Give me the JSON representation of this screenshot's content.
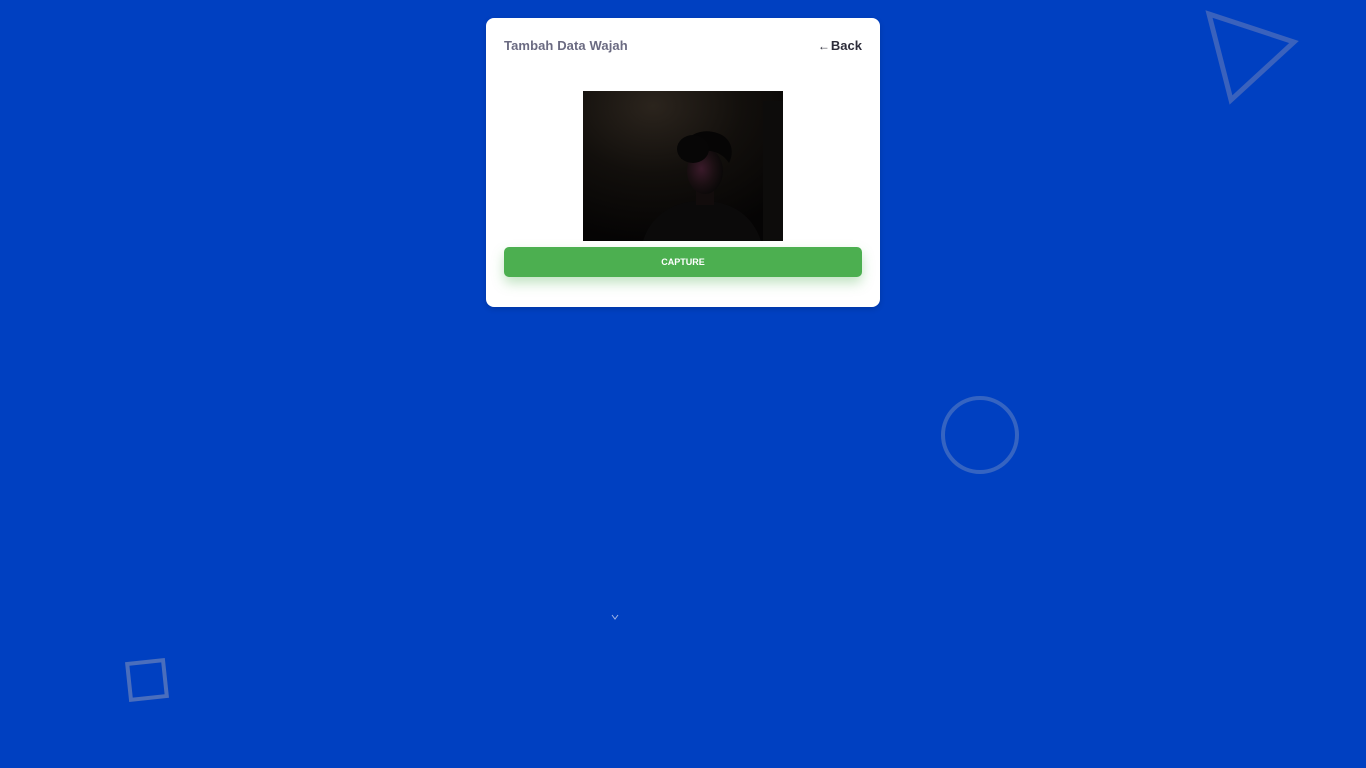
{
  "card": {
    "title": "Tambah Data Wajah",
    "back_arrow": "←",
    "back_label": "Back"
  },
  "camera": {
    "icon": "webcam-feed"
  },
  "capture_button": {
    "label": "CAPTURE"
  },
  "colors": {
    "background": "#0040c1",
    "card": "#ffffff",
    "button": "#4caf50",
    "decoration": "#3564c2"
  },
  "decorations": [
    "triangle-outline",
    "circle-outline",
    "square-outline"
  ]
}
